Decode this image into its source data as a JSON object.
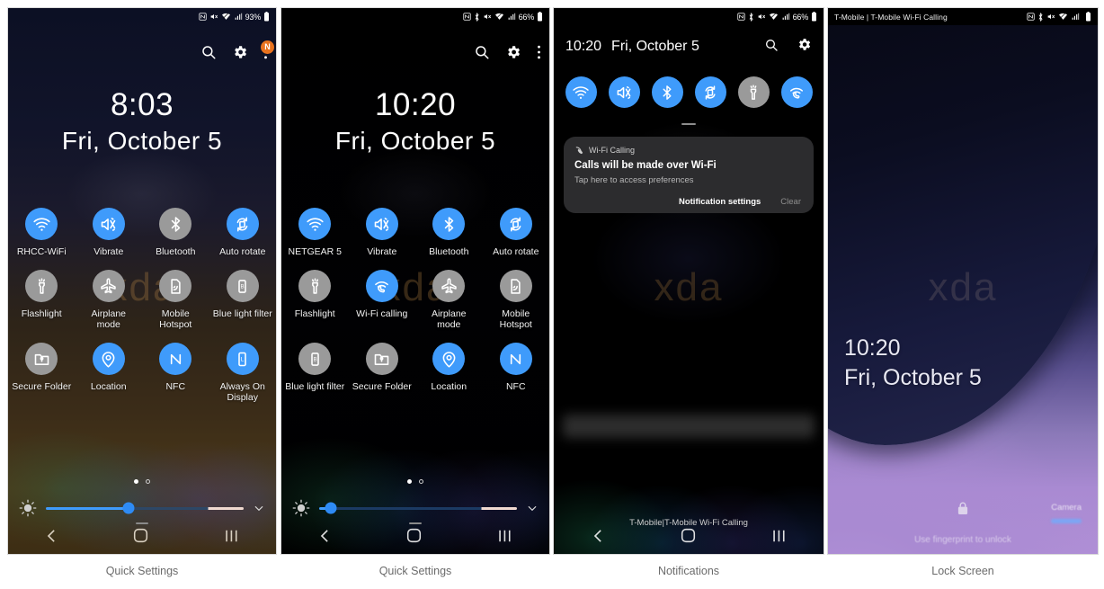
{
  "captions": [
    {
      "label": "Quick Settings"
    },
    {
      "label": "Quick Settings"
    },
    {
      "label": "Notifications"
    },
    {
      "label": "Lock Screen"
    }
  ],
  "colors": {
    "toggle_on": "#3f9bfb",
    "toggle_off": "#9a9a9a",
    "badge": "#e8731f",
    "notification_card": "#2c2c2e",
    "caption_text": "#6b6b6b"
  },
  "panel1": {
    "statusbar": {
      "left_text": "",
      "battery_percent": "93%",
      "icons": [
        "nfc-icon",
        "mute-icon",
        "wifi-icon",
        "signal-icon",
        "battery-icon"
      ]
    },
    "header_icons": [
      "search-icon",
      "gear-icon",
      "overflow-menu-icon"
    ],
    "badge_text": "N",
    "clock": {
      "time": "8:03",
      "date": "Fri, October 5"
    },
    "tiles": [
      {
        "label": "RHCC-WiFi",
        "icon": "wifi-icon",
        "state": "on"
      },
      {
        "label": "Vibrate",
        "icon": "vibrate-icon",
        "state": "on"
      },
      {
        "label": "Bluetooth",
        "icon": "bluetooth-icon",
        "state": "off"
      },
      {
        "label": "Auto rotate",
        "icon": "auto-rotate-icon",
        "state": "on"
      },
      {
        "label": "Flashlight",
        "icon": "flashlight-icon",
        "state": "off"
      },
      {
        "label": "Airplane mode",
        "icon": "airplane-icon",
        "state": "off"
      },
      {
        "label": "Mobile Hotspot",
        "icon": "hotspot-icon",
        "state": "off"
      },
      {
        "label": "Blue light filter",
        "icon": "blue-light-filter-icon",
        "state": "off"
      },
      {
        "label": "Secure Folder",
        "icon": "secure-folder-icon",
        "state": "off"
      },
      {
        "label": "Location",
        "icon": "location-icon",
        "state": "on"
      },
      {
        "label": "NFC",
        "icon": "nfc-icon",
        "state": "on"
      },
      {
        "label": "Always On Display",
        "icon": "always-on-display-icon",
        "state": "on"
      }
    ],
    "brightness_percent": 42,
    "page_dots": 2,
    "active_dot": 1,
    "watermark": "xda",
    "nav": [
      "back-icon",
      "home-icon",
      "recents-icon"
    ]
  },
  "panel2": {
    "statusbar": {
      "left_text": "",
      "battery_percent": "66%",
      "icons": [
        "nfc-icon",
        "bluetooth-icon",
        "mute-icon",
        "wifi-icon",
        "signal-icon",
        "battery-icon"
      ]
    },
    "header_icons": [
      "search-icon",
      "gear-icon",
      "overflow-menu-icon"
    ],
    "clock": {
      "time": "10:20",
      "date": "Fri, October 5"
    },
    "tiles": [
      {
        "label": "NETGEAR 5",
        "icon": "wifi-icon",
        "state": "on"
      },
      {
        "label": "Vibrate",
        "icon": "vibrate-icon",
        "state": "on"
      },
      {
        "label": "Bluetooth",
        "icon": "bluetooth-icon",
        "state": "on"
      },
      {
        "label": "Auto rotate",
        "icon": "auto-rotate-icon",
        "state": "on"
      },
      {
        "label": "Flashlight",
        "icon": "flashlight-icon",
        "state": "off"
      },
      {
        "label": "Wi-Fi calling",
        "icon": "wifi-calling-icon",
        "state": "on"
      },
      {
        "label": "Airplane mode",
        "icon": "airplane-icon",
        "state": "off"
      },
      {
        "label": "Mobile Hotspot",
        "icon": "hotspot-icon",
        "state": "off"
      },
      {
        "label": "Blue light filter",
        "icon": "blue-light-filter-icon",
        "state": "off"
      },
      {
        "label": "Secure Folder",
        "icon": "secure-folder-icon",
        "state": "off"
      },
      {
        "label": "Location",
        "icon": "location-icon",
        "state": "on"
      },
      {
        "label": "NFC",
        "icon": "nfc-icon",
        "state": "on"
      }
    ],
    "brightness_percent": 10,
    "page_dots": 2,
    "active_dot": 1,
    "watermark": "xda",
    "nav": [
      "back-icon",
      "home-icon",
      "recents-icon"
    ]
  },
  "panel3": {
    "statusbar": {
      "left_text": "",
      "battery_percent": "66%",
      "icons": [
        "nfc-icon",
        "bluetooth-icon",
        "mute-icon",
        "wifi-icon",
        "signal-icon",
        "battery-icon"
      ]
    },
    "header": {
      "time": "10:20",
      "date": "Fri, October 5"
    },
    "header_icons": [
      "search-icon",
      "gear-icon"
    ],
    "quick_toggles": [
      {
        "icon": "wifi-icon",
        "state": "on"
      },
      {
        "icon": "vibrate-icon",
        "state": "on"
      },
      {
        "icon": "bluetooth-icon",
        "state": "on"
      },
      {
        "icon": "auto-rotate-icon",
        "state": "on"
      },
      {
        "icon": "flashlight-icon",
        "state": "off"
      },
      {
        "icon": "wifi-calling-icon",
        "state": "on"
      }
    ],
    "notification": {
      "app": "Wi-Fi Calling",
      "app_icon": "wifi-calling-icon",
      "title": "Calls will be made over Wi-Fi",
      "body": "Tap here to access preferences",
      "action_primary": "Notification settings",
      "action_secondary": "Clear"
    },
    "carrier": "T-Mobile|T-Mobile Wi-Fi Calling",
    "watermark": "xda",
    "nav": [
      "back-icon",
      "home-icon",
      "recents-icon"
    ]
  },
  "panel4": {
    "statusbar": {
      "left_text": "T-Mobile | T-Mobile Wi-Fi Calling",
      "battery_percent": "",
      "icons": [
        "nfc-icon",
        "bluetooth-icon",
        "mute-icon",
        "wifi-icon",
        "signal-icon",
        "battery-icon"
      ]
    },
    "clock": {
      "time": "10:20",
      "date": "Fri, October 5"
    },
    "lock_icon": "lock-icon",
    "hint": "Use fingerprint to unlock",
    "camera_label": "Camera",
    "watermark": "xda"
  }
}
